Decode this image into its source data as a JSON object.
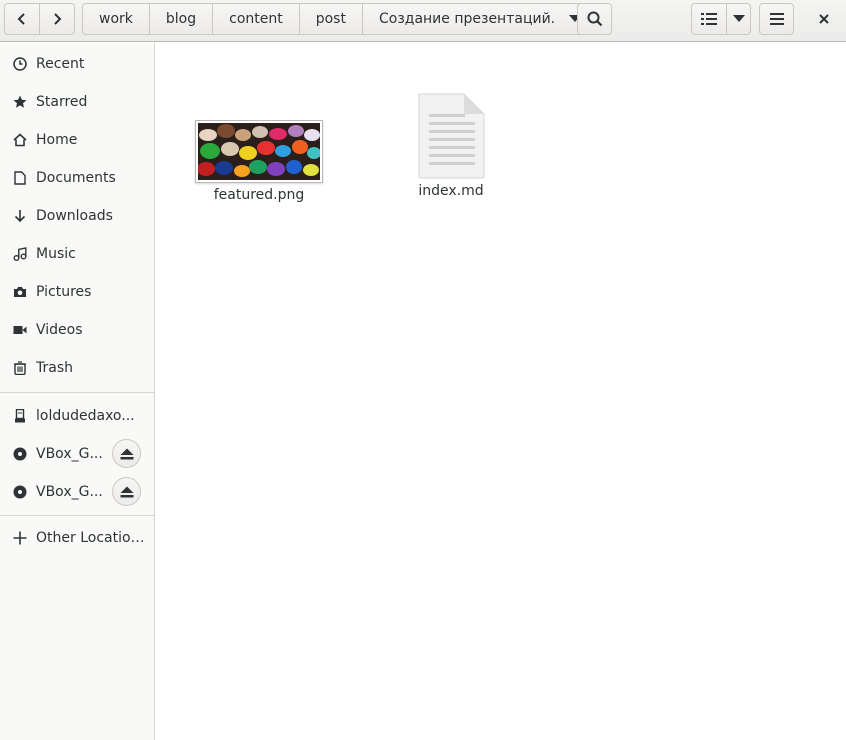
{
  "header": {
    "breadcrumbs": [
      "work",
      "blog",
      "content",
      "post",
      "Создание презентаций."
    ]
  },
  "sidebar": {
    "places": [
      {
        "label": "Recent",
        "icon": "clock-icon"
      },
      {
        "label": "Starred",
        "icon": "star-icon"
      },
      {
        "label": "Home",
        "icon": "home-icon"
      },
      {
        "label": "Documents",
        "icon": "document-icon"
      },
      {
        "label": "Downloads",
        "icon": "download-icon"
      },
      {
        "label": "Music",
        "icon": "music-icon"
      },
      {
        "label": "Pictures",
        "icon": "camera-icon"
      },
      {
        "label": "Videos",
        "icon": "video-icon"
      },
      {
        "label": "Trash",
        "icon": "trash-icon"
      }
    ],
    "devices": [
      {
        "label": "loldudedaxo...",
        "icon": "usb-drive-icon"
      },
      {
        "label": "VBox_G...",
        "icon": "optical-disc-icon"
      },
      {
        "label": "VBox_G...",
        "icon": "optical-disc-icon"
      }
    ],
    "other": {
      "label": "Other Locations",
      "icon": "plus-icon"
    }
  },
  "files": [
    {
      "name": "featured.png",
      "type": "image-thumbnail"
    },
    {
      "name": "index.md",
      "type": "text-document-icon"
    }
  ],
  "colors": {
    "header_bg": "#ebebea",
    "sidebar_bg": "#f9f9f8",
    "text": "#2e3436"
  }
}
